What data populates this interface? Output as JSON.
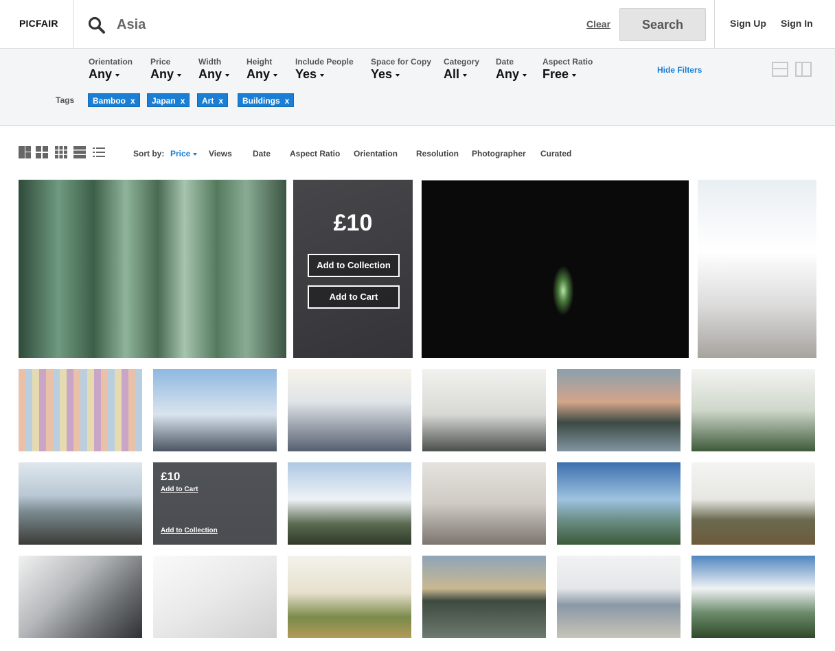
{
  "header": {
    "logo": "PICFAIR",
    "search_value": "Asia",
    "clear_label": "Clear",
    "search_button": "Search",
    "sign_up": "Sign Up",
    "sign_in": "Sign In"
  },
  "filters": [
    {
      "label": "Orientation",
      "value": "Any"
    },
    {
      "label": "Price",
      "value": "Any"
    },
    {
      "label": "Width",
      "value": "Any"
    },
    {
      "label": "Height",
      "value": "Any"
    },
    {
      "label": "Include People",
      "value": "Yes"
    },
    {
      "label": "Space for Copy",
      "value": "Yes"
    },
    {
      "label": "Category",
      "value": "All"
    },
    {
      "label": "Date",
      "value": "Any"
    },
    {
      "label": "Aspect Ratio",
      "value": "Free"
    }
  ],
  "hide_filters": "Hide Filters",
  "tags_label": "Tags",
  "tags": [
    {
      "label": "Bamboo",
      "remove": "x"
    },
    {
      "label": "Japan",
      "remove": "x"
    },
    {
      "label": "Art",
      "remove": "x"
    },
    {
      "label": "Buildings",
      "remove": "x"
    }
  ],
  "sort": {
    "label": "Sort by:",
    "options": [
      "Price",
      "Views",
      "Date",
      "Aspect Ratio",
      "Orientation",
      "Resolution",
      "Photographer",
      "Curated"
    ],
    "active": "Price"
  },
  "hover_large": {
    "price": "£10",
    "add_to_collection": "Add to Collection",
    "add_to_cart": "Add to Cart"
  },
  "hover_small": {
    "price": "£10",
    "add_to_cart": "Add to Cart",
    "add_to_collection": "Add to Collection"
  },
  "colors": {
    "accent": "#1a7fd4",
    "filter_bg": "#f4f5f7"
  },
  "photos": [
    {
      "name": "photo-bamboo-forest",
      "bg": "linear-gradient(90deg,#2f4a3a 0%,#6f9a80 15%,#3d5e48 28%,#8eb49a 40%,#4a6a52 52%,#a6c4ae 62%,#547a5e 74%,#89ab93 85%,#3c5544 100%)"
    },
    {
      "name": "photo-city-highway-aerial",
      "bg": "linear-gradient(160deg,#7d7a78,#5d5957 50%,#3c3a39)"
    },
    {
      "name": "photo-dark-forest-light",
      "bg": "radial-gradient(ellipse 4% 14% at 53% 62%,#b8e4a8 0%,#4a7a3c 45%,#0a0a0a 100%),#070707"
    },
    {
      "name": "photo-white-escalator",
      "bg": "linear-gradient(180deg,#e9eef2 0%,#ffffff 40%,#dcdcdc 70%,#a7a39e 100%)"
    },
    {
      "name": "photo-colorful-apartments",
      "bg": "repeating-linear-gradient(90deg,#e8c1a8 0 10px,#b9cfe0 10px 20px,#e6dbb0 20px 30px,#c9a6c7 30px 40px),#ddd"
    },
    {
      "name": "photo-hazy-city-view",
      "bg": "linear-gradient(180deg,#8fb8e0 0%,#d9e4ee 55%,#4b5563 100%)"
    },
    {
      "name": "photo-tower-blocks-up",
      "bg": "linear-gradient(180deg,#f7f3ea 0%,#dfe4e8 40%,#566070 100%)"
    },
    {
      "name": "photo-misty-cable-car",
      "bg": "linear-gradient(180deg,#f1f1ef 0%,#d8d8d4 55%,#4a4f4c 100%)"
    },
    {
      "name": "photo-sunset-lake",
      "bg": "linear-gradient(180deg,#8aa0ad 0%,#d4a48a 40%,#3c4a44 65%,#8295a0 100%)"
    },
    {
      "name": "photo-pendulum-trees",
      "bg": "linear-gradient(180deg,#f3f3f1 0%,#cfd7cb 50%,#3e5a3a 100%)"
    },
    {
      "name": "photo-torii-gate",
      "bg": "linear-gradient(180deg,#dfe7ee 0%,#b9c8d4 40%,#7a8a90 60%,#3c3c36 100%)"
    },
    {
      "name": "photo-hover-card",
      "bg": "linear-gradient(180deg,#9aa0a6,#6b6e70)"
    },
    {
      "name": "photo-mountain-clouds",
      "bg": "linear-gradient(180deg,#aec8e4 0%,#eef2f6 45%,#5b6a52 75%,#2f3a28 100%)"
    },
    {
      "name": "photo-smoggy-skyline",
      "bg": "linear-gradient(180deg,#e5e3df 0%,#cfcac4 50%,#7d7670 100%)"
    },
    {
      "name": "photo-bay-mountains",
      "bg": "linear-gradient(180deg,#3d6fae 0%,#9ec2e0 45%,#6b8f86 70%,#3d5a3a 100%)"
    },
    {
      "name": "photo-angkor-temple",
      "bg": "linear-gradient(180deg,#f4f4f2 0%,#e6e6e2 45%,#6a6a50 70%,#6e5a3c 100%)"
    },
    {
      "name": "photo-glass-atrium",
      "bg": "linear-gradient(135deg,#f1f1f1 0%,#b5b8ba 40%,#6d7073 70%,#2f3133 100%)"
    },
    {
      "name": "photo-white-interior",
      "bg": "linear-gradient(150deg,#fafafa 0%,#e9e9e9 50%,#cfcfcf 100%)"
    },
    {
      "name": "photo-lone-tree-ruins",
      "bg": "linear-gradient(180deg,#f4f2ec 0%,#e6e0cc 45%,#7a8a4a 75%,#b49a58 100%)"
    },
    {
      "name": "photo-highrise-reflection",
      "bg": "linear-gradient(180deg,#8ea4b8 0%,#c9b890 40%,#3d4a40 55%,#6e7a6e 100%)"
    },
    {
      "name": "photo-city-waterfront",
      "bg": "linear-gradient(180deg,#f2f2f2 0%,#e4e6e8 40%,#8a98a6 60%,#c8c4b8 100%)"
    },
    {
      "name": "photo-tropical-hills",
      "bg": "linear-gradient(180deg,#4f86c0 0%,#f0f2f4 40%,#6a8a6a 70%,#2f4a28 100%)"
    }
  ]
}
